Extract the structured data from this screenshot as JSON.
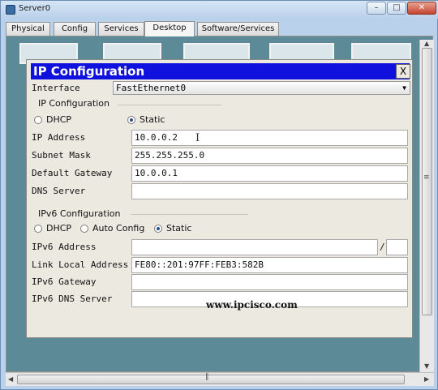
{
  "window": {
    "title": "Server0"
  },
  "tabs": [
    {
      "label": "Physical"
    },
    {
      "label": "Config"
    },
    {
      "label": "Services"
    },
    {
      "label": "Desktop"
    },
    {
      "label": "Software/Services"
    }
  ],
  "dialog": {
    "title": "IP Configuration",
    "close_label": "X",
    "interface_label": "Interface",
    "interface_value": "FastEthernet0",
    "ipv4": {
      "group_title": "IP Configuration",
      "dhcp_label": "DHCP",
      "static_label": "Static",
      "selected": "Static",
      "ip_address_label": "IP Address",
      "ip_address": "10.0.0.2",
      "subnet_mask_label": "Subnet Mask",
      "subnet_mask": "255.255.255.0",
      "default_gateway_label": "Default Gateway",
      "default_gateway": "10.0.0.1",
      "dns_server_label": "DNS Server",
      "dns_server": ""
    },
    "ipv6": {
      "group_title": "IPv6 Configuration",
      "dhcp_label": "DHCP",
      "auto_config_label": "Auto Config",
      "static_label": "Static",
      "selected": "Static",
      "address_label": "IPv6 Address",
      "address": "",
      "prefix_separator": "/",
      "prefix": "",
      "link_local_label": "Link Local Address",
      "link_local": "FE80::201:97FF:FEB3:582B",
      "gateway_label": "IPv6 Gateway",
      "gateway": "",
      "dns_label": "IPv6 DNS Server",
      "dns": ""
    }
  },
  "watermark": "www.ipcisco.com",
  "colors": {
    "dialog_title_bg": "#1111dd",
    "desktop_bg": "#5c8a96",
    "dialog_bg": "#ebe9e0"
  }
}
